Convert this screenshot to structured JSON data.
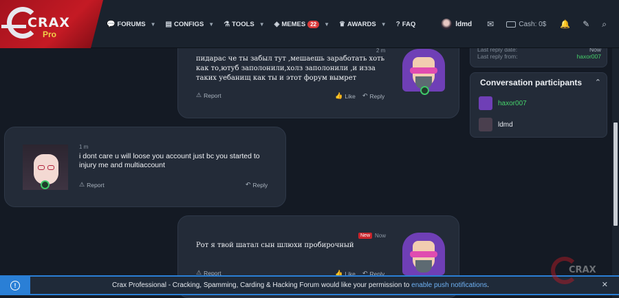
{
  "brand": {
    "logo_text": "CRAX",
    "logo_sub": "Pro"
  },
  "nav": {
    "items": [
      {
        "label": "FORUMS",
        "icon": "chat-icon"
      },
      {
        "label": "CONFIGS",
        "icon": "file-icon"
      },
      {
        "label": "TOOLS",
        "icon": "flask-icon"
      },
      {
        "label": "MEMES",
        "icon": "sticker-icon",
        "badge": "22"
      },
      {
        "label": "AWARDS",
        "icon": "trophy-icon"
      },
      {
        "label": "FAQ",
        "icon": "question-icon"
      }
    ],
    "username": "ldmd",
    "cash": "Cash: 0$"
  },
  "messages": [
    {
      "time": "2 m",
      "text": "пидарас че ты забыл тут ,мешаешь заработать хоть как то,ютуб заполонили,холз заполонили ,и изза таких уебанищ как ты и этот форум вымрет",
      "report": "Report",
      "like": "Like",
      "reply": "Reply"
    },
    {
      "time": "1 m",
      "text": "i dont care u will loose you account just bc you started to injury me and multiaccount",
      "report": "Report",
      "reply": "Reply"
    },
    {
      "time": "Now",
      "new_label": "New",
      "text": "Рот я твой шатал сын шлюхи пробирочный",
      "report": "Report",
      "like": "Like",
      "reply": "Reply"
    }
  ],
  "sidebar": {
    "last_reply_date_label": "Last reply date:",
    "last_reply_date_value": "Now",
    "last_reply_from_label": "Last reply from:",
    "last_reply_from_value": "haxor007",
    "participants_title": "Conversation participants",
    "participants": [
      {
        "name": "haxor007"
      },
      {
        "name": "ldmd"
      }
    ]
  },
  "notice": {
    "text": "Crax Professional - Cracking, Spamming, Carding & Hacking Forum would like your permission to",
    "link": "enable push notifications",
    "suffix": "."
  },
  "colors": {
    "brand_red": "#c41a24",
    "accent_blue": "#2a7fd6",
    "online_green": "#46d36b",
    "avatar_purple": "#6f3fb6"
  }
}
